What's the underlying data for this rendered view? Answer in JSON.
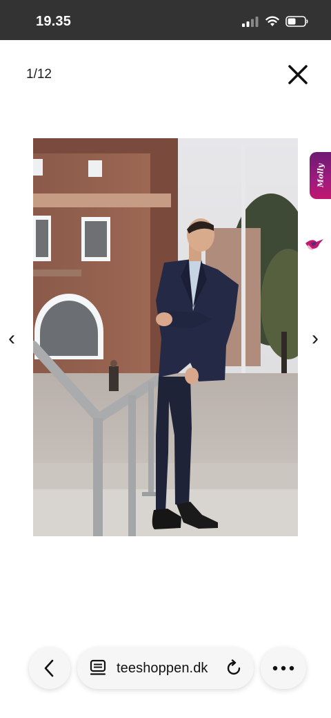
{
  "status_bar": {
    "time": "19.35"
  },
  "gallery": {
    "counter": "1/12",
    "prev_arrow": "‹",
    "next_arrow": "›",
    "photo_subject": "man-in-navy-suit-standing-by-railing"
  },
  "widgets": {
    "molly_label": "Molly"
  },
  "browser_bar": {
    "url": "teeshoppen.dk"
  },
  "icons": {
    "signal": "cellular-signal-icon",
    "wifi": "wifi-icon",
    "battery": "battery-icon",
    "close": "close-icon",
    "bird": "bird-icon",
    "back": "chevron-left-icon",
    "page": "page-icon",
    "reload": "reload-icon",
    "more": "more-dots-icon"
  },
  "colors": {
    "status_bar_bg": "#333333",
    "molly_gradient": [
      "#6d1a73",
      "#c0186f"
    ],
    "pill_bg": "#f6f6f6"
  }
}
